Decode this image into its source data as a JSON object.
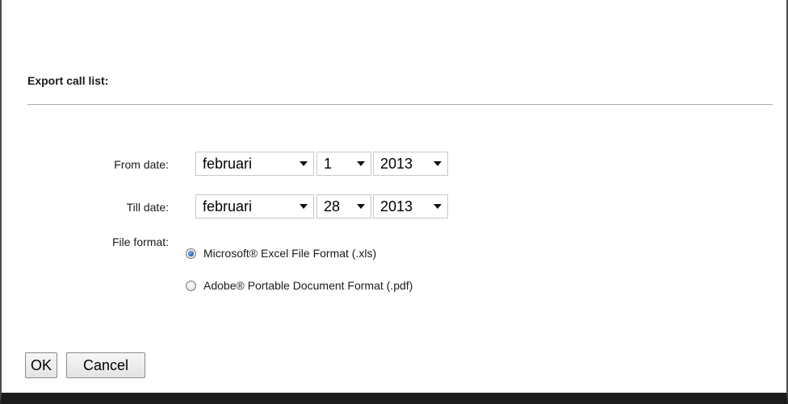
{
  "dialog": {
    "title": "Export call list:"
  },
  "from_date": {
    "label": "From date:",
    "month": "februari",
    "day": "1",
    "year": "2013"
  },
  "till_date": {
    "label": "Till date:",
    "month": "februari",
    "day": "28",
    "year": "2013"
  },
  "file_format": {
    "label": "File format:",
    "options": [
      {
        "label": "Microsoft® Excel File Format (.xls)",
        "checked": true
      },
      {
        "label": "Adobe® Portable Document Format (.pdf)",
        "checked": false
      }
    ]
  },
  "buttons": {
    "ok": "OK",
    "cancel": "Cancel"
  },
  "colors": {
    "accent_radio": "#2a66c4",
    "bottom_border": "#1c1c1c"
  }
}
